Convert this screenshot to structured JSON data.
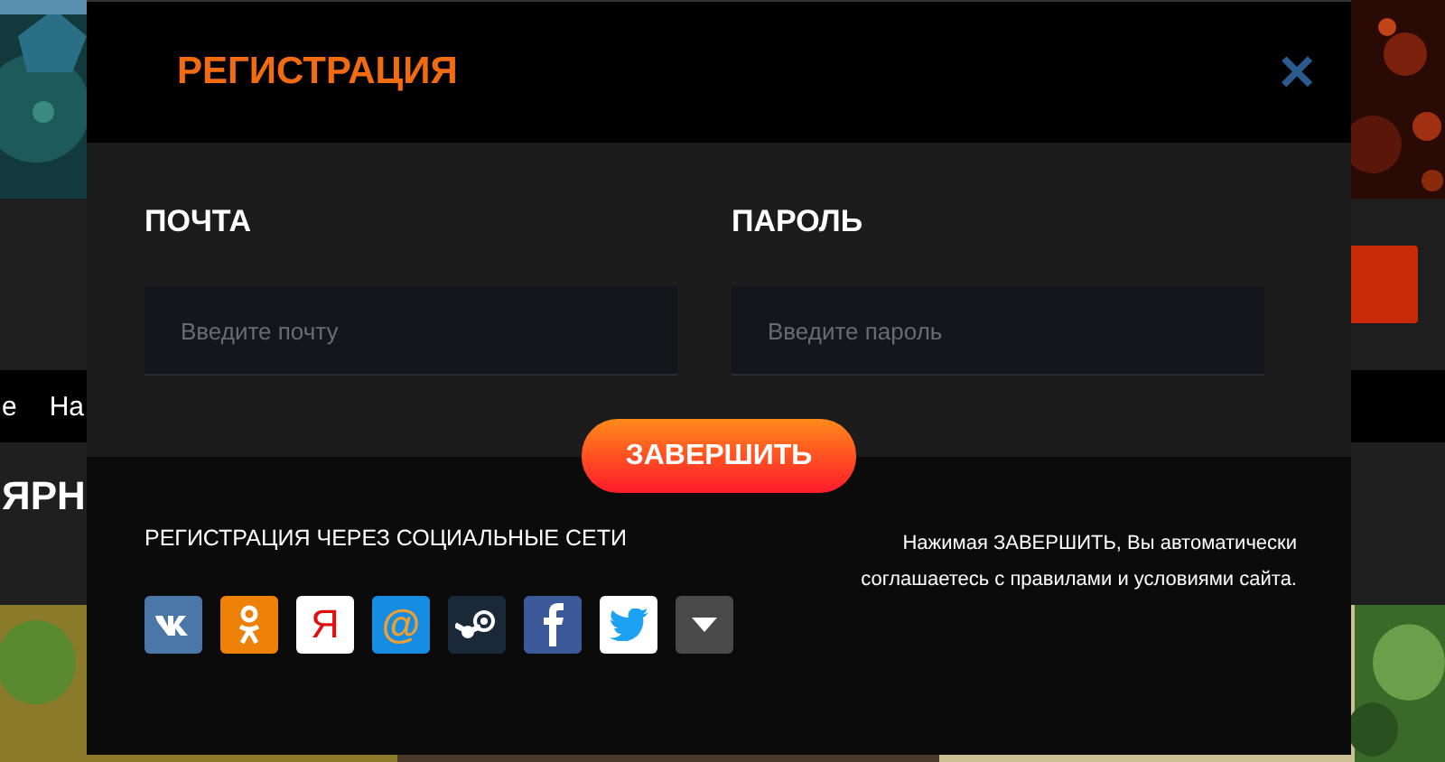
{
  "background": {
    "nav_items": [
      "е",
      "На"
    ],
    "heading": "ЯРН"
  },
  "modal": {
    "title": "РЕГИСТРАЦИЯ",
    "close": "×",
    "fields": [
      {
        "label": "ПОЧТА",
        "placeholder": "Введите почту"
      },
      {
        "label": "ПАРОЛЬ",
        "placeholder": "Введите пароль"
      }
    ],
    "submit": "ЗАВЕРШИТЬ",
    "social_title": "РЕГИСТРАЦИЯ ЧЕРЕЗ СОЦИАЛЬНЫЕ СЕТИ",
    "social": [
      {
        "kind": "vk"
      },
      {
        "kind": "ok"
      },
      {
        "kind": "yandex",
        "label": "Я"
      },
      {
        "kind": "mail",
        "label": "@"
      },
      {
        "kind": "steam"
      },
      {
        "kind": "facebook"
      },
      {
        "kind": "twitter"
      },
      {
        "kind": "more"
      }
    ],
    "terms": "Нажимая ЗАВЕРШИТЬ, Вы автоматически соглашаетесь с правилами и условиями сайта."
  }
}
